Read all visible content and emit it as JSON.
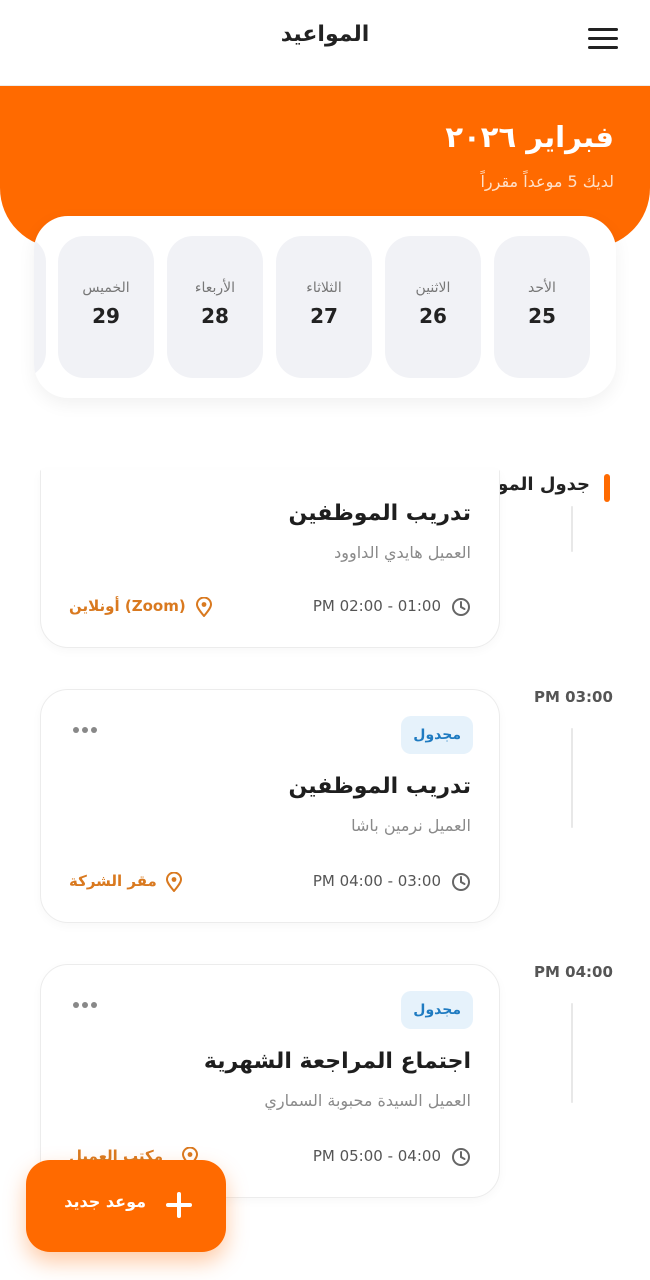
{
  "header": {
    "title": "المواعيد"
  },
  "hero": {
    "month": "فبراير ٢٠٢٦",
    "subtitle": "لديك 5 موعداً مقرراً"
  },
  "week": [
    {
      "name": "الأحد",
      "num": "25"
    },
    {
      "name": "الاثنين",
      "num": "26"
    },
    {
      "name": "الثلاثاء",
      "num": "27"
    },
    {
      "name": "الأربعاء",
      "num": "28"
    },
    {
      "name": "الخميس",
      "num": "29"
    }
  ],
  "section": {
    "title": "جدول المواعيد"
  },
  "slots": [
    {
      "time": "PM 03:00"
    },
    {
      "time": "PM 04:00"
    }
  ],
  "cards": [
    {
      "badge": "",
      "title": "تدريب الموظفين",
      "client": "العميل هايدي الداوود",
      "time": "PM 02:00 - 01:00",
      "location": "أونلاين (Zoom)"
    },
    {
      "badge": "مجدول",
      "title": "تدريب الموظفين",
      "client": "العميل نرمين باشا",
      "time": "PM 04:00 - 03:00",
      "location": "مقر الشركة"
    },
    {
      "badge": "مجدول",
      "title": "اجتماع المراجعة الشهرية",
      "client": "العميل السيدة محبوبة السماري",
      "time": "PM 05:00 - 04:00",
      "location": "مكتب العميل"
    }
  ],
  "fab": {
    "label": "موعد جديد"
  },
  "colors": {
    "accent": "#ff6a00",
    "badge_bg": "#e6f2fb",
    "badge_text": "#1f7bc1",
    "location": "#d9791f"
  },
  "icons": {
    "menu": "hamburger-icon",
    "clock": "clock-icon",
    "pin": "location-pin-icon",
    "more": "more-dots-icon",
    "add": "plus-icon"
  }
}
